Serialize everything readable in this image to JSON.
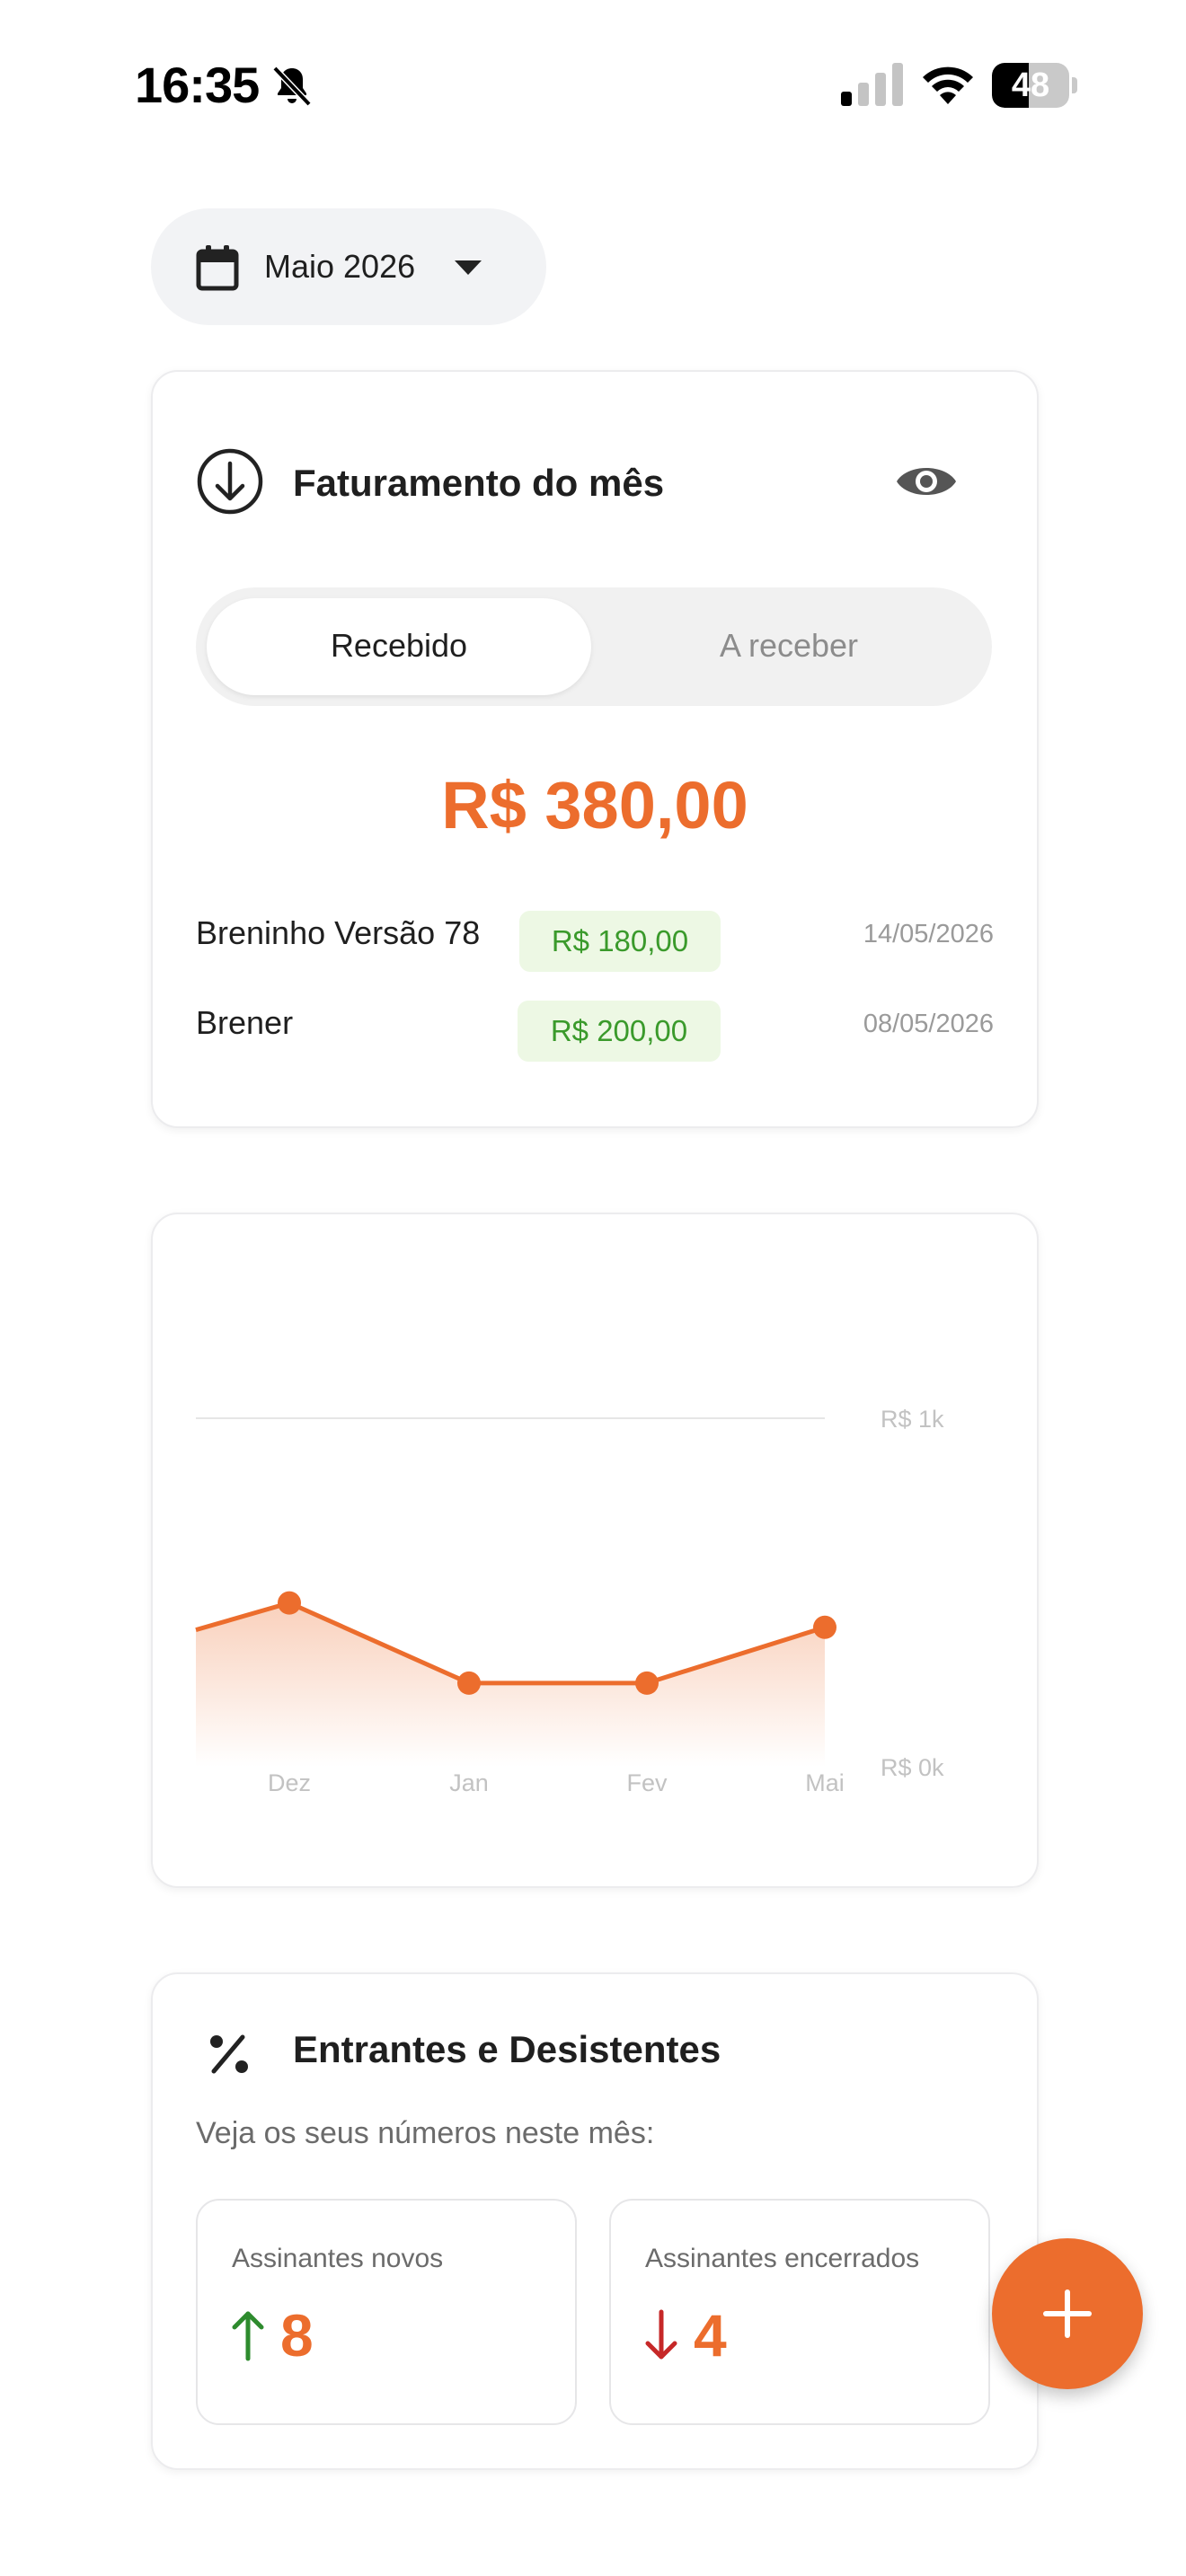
{
  "status_bar": {
    "time": "16:35",
    "battery": "48",
    "battery_level": 0.48
  },
  "month_selector": {
    "label": "Maio 2026"
  },
  "revenue_card": {
    "title": "Faturamento do mês",
    "tabs": [
      "Recebido",
      "A receber"
    ],
    "active_tab": "Recebido",
    "total": "R$ 380,00",
    "rows": [
      {
        "name": "Breninho Versão 78",
        "amount": "R$ 180,00",
        "date": "14/05/2026"
      },
      {
        "name": "Brener",
        "amount": "R$ 200,00",
        "date": "08/05/2026"
      }
    ]
  },
  "chart_data": {
    "type": "area",
    "categories": [
      "Dez",
      "Jan",
      "Fev",
      "Mai"
    ],
    "values": [
      470,
      240,
      240,
      400
    ],
    "y_tick_labels": [
      "R$ 1k",
      "R$ 0k"
    ],
    "ylim": [
      0,
      1000
    ],
    "color": "#ec6d2d",
    "grid": true
  },
  "entrants_card": {
    "title": "Entrantes e Desistentes",
    "subtitle": "Veja os seus números neste mês:",
    "new_label": "Assinantes novos",
    "new_value": "8",
    "ended_label": "Assinantes encerrados",
    "ended_value": "4"
  },
  "colors": {
    "accent": "#ec6d2d",
    "positive": "#2e8b2e",
    "negative": "#c62828",
    "badge_bg": "#edf8e4"
  },
  "icons": [
    "bell-off-icon",
    "signal-icon",
    "wifi-icon",
    "battery-icon",
    "calendar-icon",
    "caret-down-icon",
    "arrow-down-circle-icon",
    "eye-icon",
    "percent-icon",
    "arrow-up-icon",
    "arrow-down-icon",
    "plus-icon"
  ]
}
